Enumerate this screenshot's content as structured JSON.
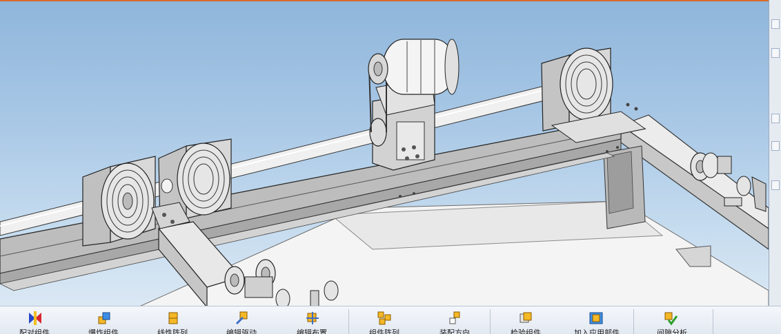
{
  "window": {
    "accent_color": "#d86a2a"
  },
  "viewport": {
    "content": "3D CAD model of conveyor frame with pulleys, shaft and motor",
    "background_top": "#8fb6db",
    "background_bottom": "#dbe8f4"
  },
  "right_strip": {
    "buttons": [
      "panel-button",
      "panel-button",
      "panel-button",
      "panel-button",
      "panel-button"
    ]
  },
  "toolbar": {
    "items": [
      {
        "label": "配对组件",
        "icon": "mate-components-icon"
      },
      {
        "label": "爆炸组件",
        "icon": "exploded-view-icon"
      },
      {
        "label": "线性阵列",
        "icon": "linear-pattern-icon"
      },
      {
        "label": "编辑驱动",
        "icon": "edit-drive-icon"
      },
      {
        "label": "编辑布置",
        "icon": "edit-arrangement-icon"
      },
      {
        "label": "组件阵列",
        "icon": "component-array-icon"
      },
      {
        "label": "装配方向",
        "icon": "assembly-direction-icon"
      },
      {
        "label": "检验组件",
        "icon": "check-components-icon"
      },
      {
        "label": "加入应用部件",
        "icon": "add-part-icon"
      },
      {
        "label": "间隙分析",
        "icon": "clearance-analysis-icon"
      }
    ]
  }
}
